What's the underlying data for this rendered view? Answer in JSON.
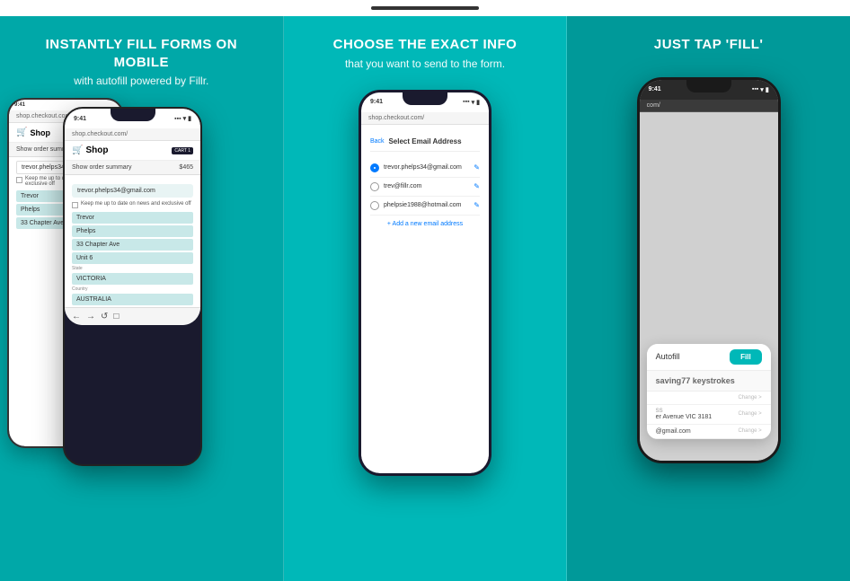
{
  "topBar": {
    "indicator": "top-indicator"
  },
  "panels": [
    {
      "id": "panel-1",
      "title": "INSTANTLY FILL FORMS ON MOBILE",
      "subtitle": "with autofill powered by Fillr.",
      "background": "#00a8a8"
    },
    {
      "id": "panel-2",
      "title": "CHOOSE THE EXACT INFO",
      "subtitle": "that you want to send to the form.",
      "background": "#00b8b8"
    },
    {
      "id": "panel-3",
      "title": "JUST TAP 'FILL'",
      "subtitle": "",
      "background": "#009999"
    }
  ],
  "phone1": {
    "statusTime": "9:41",
    "url": "shop.checkout.com/",
    "shopTitle": "Shop",
    "cartLabel": "CART  1",
    "orderSummary": "Show order summary",
    "orderPrice": "$465",
    "emailPlaceholder": "trevor.phelps34@gmail.com",
    "checkboxText": "Keep me up to date on news and exclusive off",
    "fields": [
      "Trevor",
      "Phelps",
      "33 Chapter Ave",
      "Unit 6",
      "VICTORIA",
      "AUSTRALIA"
    ],
    "stateLabel": "State",
    "countryLabel": "Country"
  },
  "phone2": {
    "statusTime": "9:41",
    "url": "shop.checkout.com/",
    "backBtn": "Back",
    "selectTitle": "Select Email Address",
    "emails": [
      {
        "address": "trevor.phelps34@gmail.com",
        "selected": true
      },
      {
        "address": "trev@fillr.com",
        "selected": false
      },
      {
        "address": "phelpsie1988@hotmail.com",
        "selected": false
      }
    ],
    "addEmailLink": "+ Add a new email address"
  },
  "phone3": {
    "statusTime": "9:41",
    "url": "com/",
    "autofillLabel": "Autofill",
    "fillButton": "Fill",
    "keystrokesText": "saving",
    "keystrokesCount": "77",
    "keystrokesSuffix": " keystrokes",
    "sections": [
      {
        "label": "",
        "value": "",
        "change": "Change >"
      },
      {
        "label": "SS",
        "value": "er Avenue VIC 3181",
        "change": "Change >"
      },
      {
        "label": "",
        "value": "@gmail.com",
        "change": "Change >"
      }
    ]
  }
}
